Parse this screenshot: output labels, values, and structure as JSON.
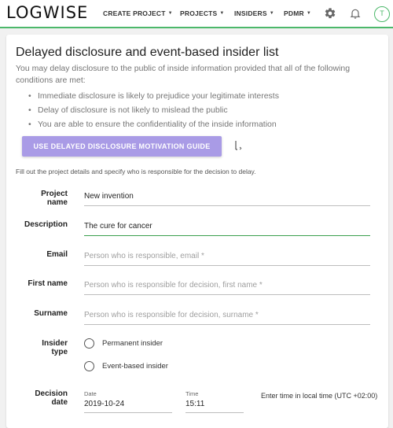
{
  "nav": {
    "logo": "LOGWISE",
    "items": [
      {
        "label": "CREATE PROJECT"
      },
      {
        "label": "PROJECTS"
      },
      {
        "label": "INSIDERS"
      },
      {
        "label": "PDMR"
      }
    ],
    "avatar_initial": "T",
    "icons": [
      "gear-icon",
      "bell-icon"
    ]
  },
  "page": {
    "title": "Delayed disclosure and event-based insider list",
    "intro": "You may delay disclosure to the public of inside information provided that all of the following conditions are met:",
    "conditions": [
      "Immediate disclosure is likely to prejudice your legitimate interests",
      "Delay of disclosure is not likely to mislead the public",
      "You are able to ensure the confidentiality of the inside information"
    ],
    "guide_button": "USE DELAYED DISCLOSURE MOTIVATION GUIDE",
    "helper_text": "Fill out the project details and specify who is responsible for the decision to delay."
  },
  "form": {
    "project_name": {
      "label_line1": "Project",
      "label_line2": "name",
      "value": "New invention"
    },
    "description": {
      "label": "Description",
      "value": "The cure for cancer"
    },
    "email": {
      "label": "Email",
      "placeholder": "Person who is responsible, email *"
    },
    "first_name": {
      "label": "First name",
      "placeholder": "Person who is responsible for decision, first name *"
    },
    "surname": {
      "label": "Surname",
      "placeholder": "Person who is responsible for decision, surname *"
    },
    "insider_type": {
      "label_line1": "Insider",
      "label_line2": "type",
      "options": [
        "Permanent insider",
        "Event-based insider"
      ]
    },
    "decision_date": {
      "label_line1": "Decision",
      "label_line2": "date",
      "date_label": "Date",
      "date_value": "2019-10-24",
      "time_label": "Time",
      "time_value": "15:11",
      "tz_note": "Enter time in local time (UTC +02:00)"
    }
  },
  "colors": {
    "accent_green": "#4cb86a",
    "button_purple": "#a99be6"
  }
}
